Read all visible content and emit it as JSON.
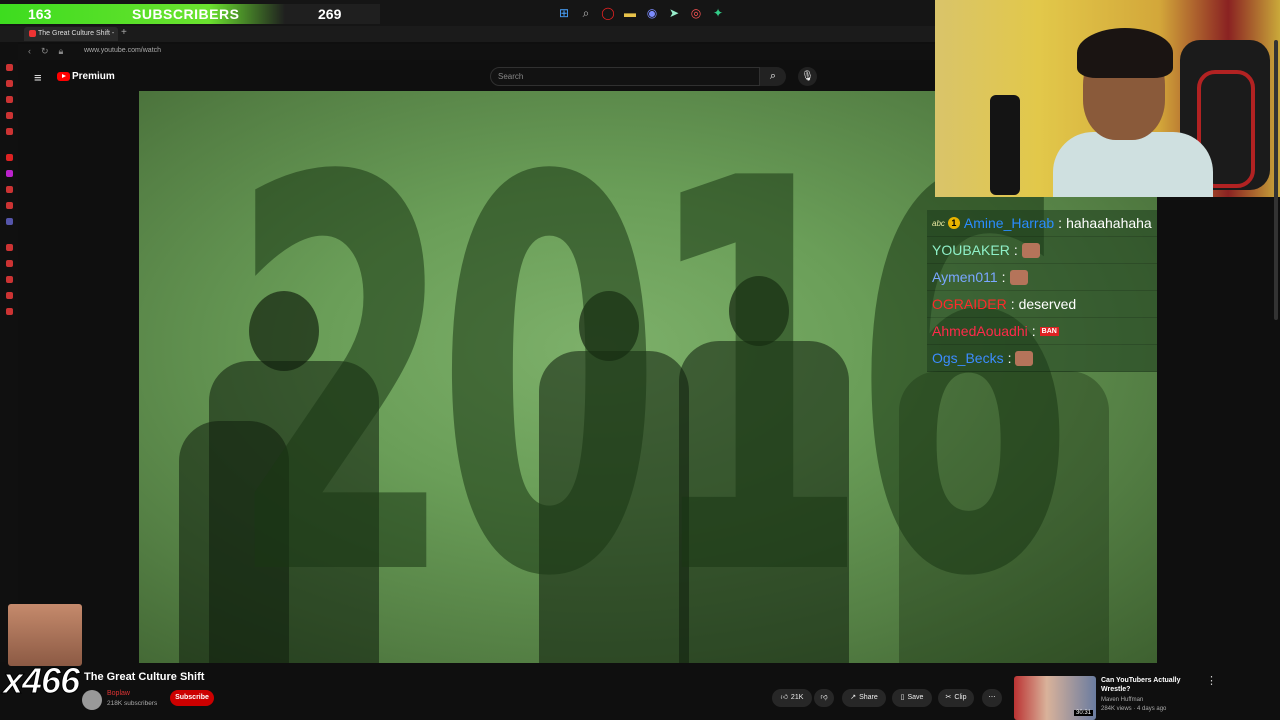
{
  "stream_overlay": {
    "subscriber_goal": {
      "current": "163",
      "label": "SUBSCRIBERS",
      "target": "269"
    }
  },
  "browser": {
    "tab_title": "The Great Culture Shift - ",
    "url": "www.youtube.com/watch"
  },
  "youtube": {
    "brand": "Premium",
    "search_placeholder": "Search"
  },
  "video": {
    "overlay_text": "2016",
    "title": "The Great Culture Shift",
    "channel_name": "Boplaw",
    "channel_subs": "218K subscribers",
    "subscribe_label": "Subscribe",
    "like_count": "21K",
    "share_label": "Share",
    "save_label": "Save",
    "clip_label": "Clip"
  },
  "chat": [
    {
      "name": "Amine_Harrab",
      "color": "#2a8cff",
      "message": "hahaahahaha",
      "badge": "1"
    },
    {
      "name": "YOUBAKER",
      "color": "#8ff0c8",
      "message": "",
      "emote": true
    },
    {
      "name": "Aymen011",
      "color": "#7aa7ff",
      "message": "",
      "emote": true
    },
    {
      "name": "OGRAIDER",
      "color": "#ff2a2a",
      "message": "deserved"
    },
    {
      "name": "AhmedAouadhi",
      "color": "#ff2a4a",
      "message": "",
      "ban": "BAN"
    },
    {
      "name": "Ogs_Becks",
      "color": "#3c8cff",
      "message": "",
      "emote": true
    }
  ],
  "meme_counter": "x466",
  "recommendation": {
    "title": "Can YouTubers Actually Wrestle?",
    "channel": "Maven Huffman",
    "meta": "284K views · 4 days ago",
    "duration": "30:31"
  }
}
